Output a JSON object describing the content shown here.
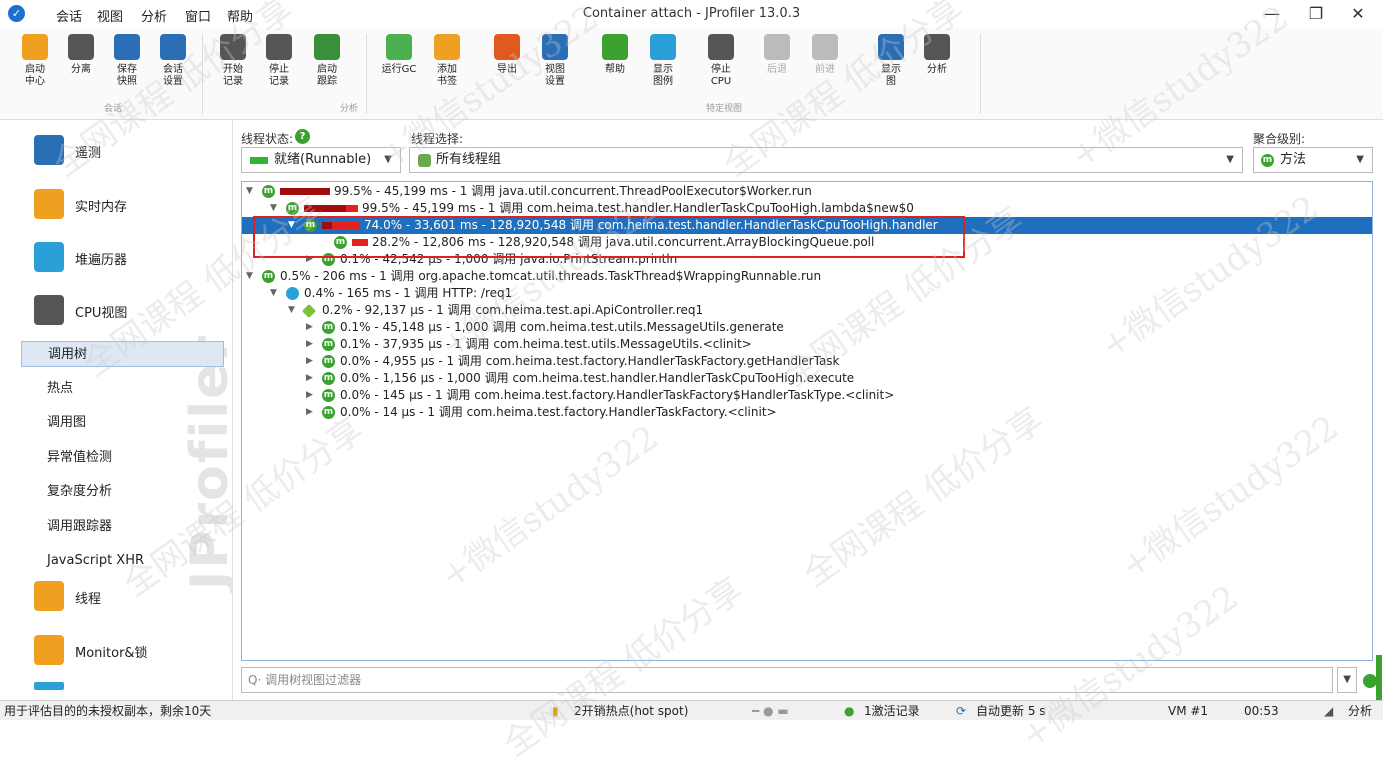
{
  "app": {
    "title": "Container attach - JProfiler 13.0.3"
  },
  "menu": [
    "会话",
    "视图",
    "分析",
    "窗口",
    "帮助"
  ],
  "toolbar": {
    "buttons": [
      {
        "label1": "启动",
        "label2": "中心",
        "icon": "start-center-icon",
        "color": "#f0a020"
      },
      {
        "label1": "分离",
        "label2": "",
        "icon": "detach-icon",
        "color": "#555"
      },
      {
        "label1": "保存",
        "label2": "快照",
        "icon": "save-icon",
        "color": "#2a6fb5"
      },
      {
        "label1": "会话",
        "label2": "设置",
        "icon": "session-settings-icon",
        "color": "#2a6fb5"
      },
      {
        "label1": "开始",
        "label2": "记录",
        "icon": "start-recording-icon",
        "color": "#555"
      },
      {
        "label1": "停止",
        "label2": "记录",
        "icon": "stop-recording-icon",
        "color": "#555"
      },
      {
        "label1": "启动",
        "label2": "跟踪",
        "icon": "start-tracking-icon",
        "color": "#3a8f3a"
      },
      {
        "label1": "运行GC",
        "label2": "",
        "icon": "run-gc-icon",
        "color": "#4caf50"
      },
      {
        "label1": "添加",
        "label2": "书签",
        "icon": "add-bookmark-icon",
        "color": "#f0a020"
      },
      {
        "label1": "导出",
        "label2": "",
        "icon": "export-icon",
        "color": "#e05a20"
      },
      {
        "label1": "视图",
        "label2": "设置",
        "icon": "view-settings-icon",
        "color": "#2a6fb5"
      },
      {
        "label1": "帮助",
        "label2": "",
        "icon": "help-icon",
        "color": "#3ba12f"
      },
      {
        "label1": "显示",
        "label2": "图例",
        "icon": "show-legend-icon",
        "color": "#2a9fd8"
      },
      {
        "label1": "停止",
        "label2": "CPU",
        "icon": "stop-cpu-icon",
        "color": "#555"
      },
      {
        "label1": "后退",
        "label2": "",
        "icon": "back-icon",
        "color": "#bbb"
      },
      {
        "label1": "前进",
        "label2": "",
        "icon": "forward-icon",
        "color": "#bbb"
      },
      {
        "label1": "显示",
        "label2": "图",
        "icon": "show-graph-icon",
        "color": "#2a6fb5"
      },
      {
        "label1": "分析",
        "label2": "",
        "icon": "analyze-icon",
        "color": "#555"
      }
    ],
    "groups": [
      "会话",
      "分析",
      "特定视图"
    ]
  },
  "sidebar": {
    "items": [
      {
        "label": "遥测",
        "icon": "telemetry-icon",
        "color": "#2a6fb5"
      },
      {
        "label": "实时内存",
        "icon": "live-memory-icon",
        "color": "#f0a020"
      },
      {
        "label": "堆遍历器",
        "icon": "heap-walker-icon",
        "color": "#2a9fd8"
      },
      {
        "label": "CPU视图",
        "icon": "cpu-views-icon",
        "color": "#555"
      }
    ],
    "subitems": [
      "调用树",
      "热点",
      "调用图",
      "异常值检测",
      "复杂度分析",
      "调用跟踪器",
      "JavaScript XHR"
    ],
    "items2": [
      {
        "label": "线程",
        "icon": "threads-icon",
        "color": "#f0a020"
      },
      {
        "label": "Monitor&锁",
        "icon": "monitor-lock-icon",
        "color": "#f0a020"
      }
    ],
    "watermark": "JProfiler"
  },
  "filters": {
    "thread_state_label": "线程状态:",
    "thread_state_value": "就绪(Runnable)",
    "thread_select_label": "线程选择:",
    "thread_select_value": "所有线程组",
    "aggregation_label": "聚合级别:",
    "aggregation_value": "方法"
  },
  "tree": {
    "rows": [
      {
        "text": "99.5% - 45,199 ms - 1 调用 java.util.concurrent.ThreadPoolExecutor$Worker.run",
        "pct": 99.5
      },
      {
        "text": "99.5% - 45,199 ms - 1 调用 com.heima.test.handler.HandlerTaskCpuTooHigh.lambda$new$0",
        "pct": 99.5
      },
      {
        "text": "74.0% - 33,601 ms - 128,920,548 调用 com.heima.test.handler.HandlerTaskCpuTooHigh.handler",
        "pct": 74.0
      },
      {
        "text": "28.2% - 12,806 ms - 128,920,548 调用 java.util.concurrent.ArrayBlockingQueue.poll",
        "pct": 28.2
      },
      {
        "text": "0.1% - 42,542 µs - 1,000 调用 java.io.PrintStream.println",
        "pct": 0.1
      },
      {
        "text": "0.5% - 206 ms - 1 调用 org.apache.tomcat.util.threads.TaskThread$WrappingRunnable.run",
        "pct": 0.5
      },
      {
        "text": "0.4% - 165 ms - 1 调用 HTTP: /req1",
        "pct": 0.4
      },
      {
        "text": "0.2% - 92,137 µs - 1 调用 com.heima.test.api.ApiController.req1",
        "pct": 0.2
      },
      {
        "text": "0.1% - 45,148 µs - 1,000 调用 com.heima.test.utils.MessageUtils.generate",
        "pct": 0.1
      },
      {
        "text": "0.1% - 37,935 µs - 1 调用 com.heima.test.utils.MessageUtils.<clinit>",
        "pct": 0.1
      },
      {
        "text": "0.0% - 4,955 µs - 1 调用 com.heima.test.factory.HandlerTaskFactory.getHandlerTask",
        "pct": 0.0
      },
      {
        "text": "0.0% - 1,156 µs - 1,000 调用 com.heima.test.handler.HandlerTaskCpuTooHigh.execute",
        "pct": 0.0
      },
      {
        "text": "0.0% - 145 µs - 1 调用 com.heima.test.factory.HandlerTaskFactory$HandlerTaskType.<clinit>",
        "pct": 0.0
      },
      {
        "text": "0.0% - 14 µs - 1 调用 com.heima.test.factory.HandlerTaskFactory.<clinit>",
        "pct": 0.0
      }
    ],
    "filter_placeholder": "调用树视图过滤器"
  },
  "status": {
    "left": "用于评估目的的未授权副本，剩余10天",
    "hotspot": "2开销热点(hot spot)",
    "records": "1激活记录",
    "autoupdate": "自动更新 5 s",
    "vm": "VM #1",
    "time": "00:53",
    "analyze": "分析"
  },
  "watermarks": [
    "全网课程 低价分享",
    "+微信study322"
  ]
}
